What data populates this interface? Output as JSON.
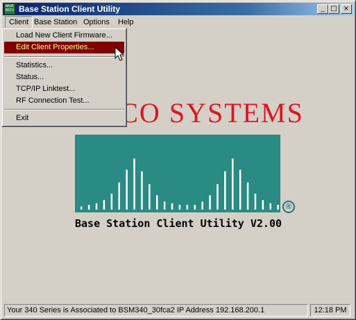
{
  "window": {
    "title": "Base Station Client Utility",
    "icon_label": "BASE BSCU",
    "buttons": [
      "_",
      "□",
      "×"
    ]
  },
  "menubar": [
    "Client",
    "Base Station",
    "Options",
    "Help"
  ],
  "client_menu": {
    "items": [
      "Load New Client Firmware...",
      "Edit Client Properties...",
      "Statistics...",
      "Status...",
      "TCP/IP Linktest...",
      "RF Connection Test...",
      "Exit"
    ],
    "highlighted": "Edit Client Properties..."
  },
  "logo": {
    "brand_text": "CISCO SYSTEMS",
    "registered_mark": "®",
    "subtitle": "Base Station Client Utility V2.00",
    "bar_heights": [
      2,
      3,
      4,
      6,
      10,
      17,
      25,
      32,
      24,
      16,
      9,
      5,
      4,
      3,
      3,
      3,
      5,
      9,
      16,
      24,
      32,
      25,
      17,
      10,
      6,
      4,
      3,
      2
    ],
    "colors": {
      "red": "#e0141e",
      "teal": "#2a8a84"
    }
  },
  "statusbar": {
    "message": "Your 340 Series is Associated to BSM340_30fca2   IP Address 192.168.200.1",
    "time": "12:18 PM"
  }
}
